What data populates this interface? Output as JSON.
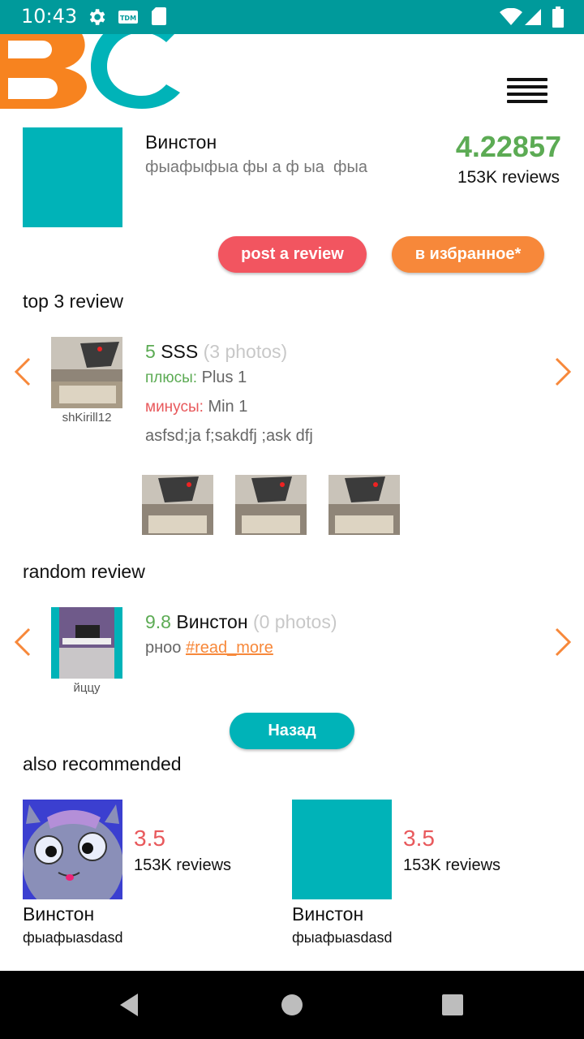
{
  "status_bar": {
    "time": "10:43",
    "icons": [
      "gear-icon",
      "tdm-icon",
      "sd-card-icon",
      "wifi-icon",
      "signal-icon",
      "battery-icon"
    ]
  },
  "header": {
    "logo_letters": "BC",
    "menu_icon": "hamburger-menu-icon"
  },
  "product": {
    "name": "Винстон",
    "description": "фыафыфыа фы а ф ыа  фыа",
    "rating": "4.22857",
    "reviews": "153K reviews",
    "thumb_color": "#00b3b8"
  },
  "actions": {
    "post_review": "post a review",
    "favorite": "в избранное*"
  },
  "top_review": {
    "section_title": "top 3 review",
    "user": "shKirill12",
    "score": "5",
    "title": "SSS",
    "photos": "(3 photos)",
    "plus_label": "плюсы:",
    "plus_value": "Plus 1",
    "minus_label": "минусы:",
    "minus_value": "Min 1",
    "text": "asfsd;ja f;sakdfj ;ask dfj"
  },
  "random_review": {
    "section_title": "random review",
    "user": "йццу",
    "score": "9.8",
    "title": "Винстон",
    "photos": "(0 photos)",
    "text": "рноо",
    "read_more": "#read_more"
  },
  "back_button": "Назад",
  "recommended": {
    "section_title": "also recommended",
    "items": [
      {
        "rating": "3.5",
        "reviews": "153K reviews",
        "name": "Винстон",
        "desc": "фыафыasdasd"
      },
      {
        "rating": "3.5",
        "reviews": "153K reviews",
        "name": "Винстон",
        "desc": "фыафыasdasd"
      }
    ]
  },
  "colors": {
    "status_bar": "#009a9b",
    "accent_teal": "#00b3b8",
    "accent_orange": "#f7883a",
    "accent_red": "#f25560",
    "rating_green": "#5cab54"
  }
}
